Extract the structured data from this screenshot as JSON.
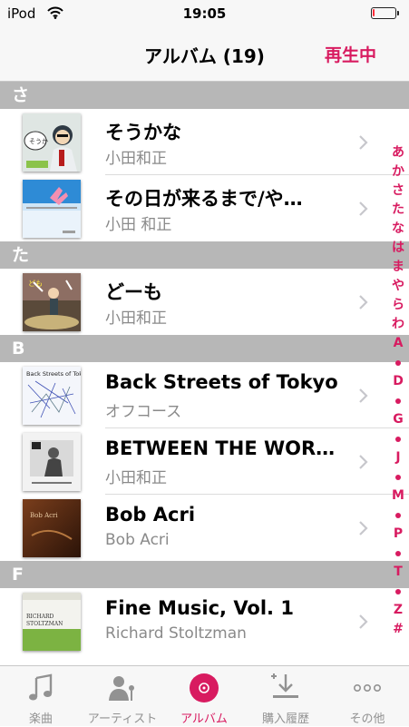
{
  "status": {
    "carrier": "iPod",
    "time": "19:05",
    "battery_level": 0.1
  },
  "nav": {
    "title": "アルバム (19)",
    "now_playing": "再生中"
  },
  "sections": [
    {
      "letter": "さ",
      "albums": [
        {
          "title": "そうかな",
          "artist": "小田和正"
        },
        {
          "title": "その日が来るまで/や…",
          "artist": "小田 和正"
        }
      ]
    },
    {
      "letter": "た",
      "albums": [
        {
          "title": "どーも",
          "artist": "小田和正"
        }
      ]
    },
    {
      "letter": "B",
      "albums": [
        {
          "title": "Back Streets of Tokyo",
          "artist": "オフコース"
        },
        {
          "title": "BETWEEN THE WOR…",
          "artist": "小田和正"
        },
        {
          "title": "Bob Acri",
          "artist": "Bob Acri"
        }
      ]
    },
    {
      "letter": "F",
      "albums": [
        {
          "title": "Fine Music, Vol. 1",
          "artist": "Richard Stoltzman"
        }
      ]
    }
  ],
  "index": [
    "あ",
    "か",
    "さ",
    "た",
    "な",
    "は",
    "ま",
    "や",
    "ら",
    "わ",
    "A",
    "•",
    "D",
    "•",
    "G",
    "•",
    "J",
    "•",
    "M",
    "•",
    "P",
    "•",
    "T",
    "•",
    "Z",
    "#"
  ],
  "tabs": [
    {
      "label": "楽曲",
      "icon": "music-note-icon"
    },
    {
      "label": "アーティスト",
      "icon": "artist-icon"
    },
    {
      "label": "アルバム",
      "icon": "album-disc-icon",
      "active": true
    },
    {
      "label": "購入履歴",
      "icon": "purchased-icon"
    },
    {
      "label": "その他",
      "icon": "more-icon"
    }
  ],
  "colors": {
    "accent": "#d81b60",
    "section_bg": "#b7b7b7",
    "bar_bg": "#f7f7f7",
    "battery_low": "#ff2d3a"
  }
}
